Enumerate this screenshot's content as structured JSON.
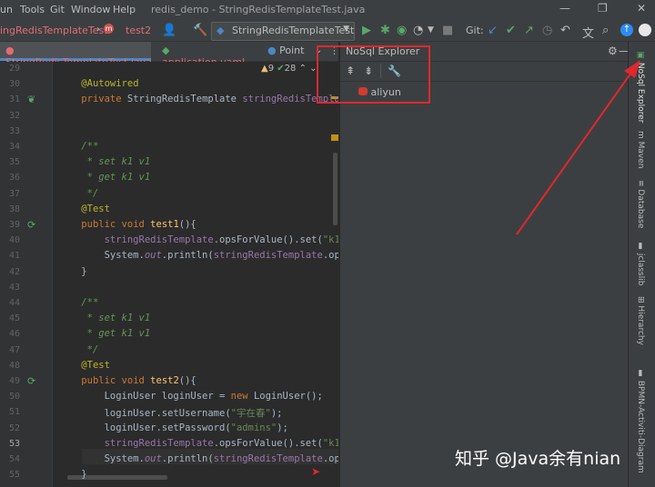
{
  "menu": {
    "items": [
      "un",
      "Tools",
      "Git",
      "Window",
      "Help"
    ],
    "window_title": "redis_demo - StringRedisTemplateTest.java"
  },
  "toolbar": {
    "breadcrumb_class": "ingRedisTemplateTest",
    "breadcrumb_method": "test2",
    "run_config": "StringRedisTemplateTest",
    "git_label": "Git:"
  },
  "tabs": [
    {
      "label": "StringRedisTemplateTest.java",
      "active": true
    },
    {
      "label": "application.yaml",
      "active": false
    },
    {
      "label": "Point",
      "active": false
    }
  ],
  "inspections": {
    "warnings": "9",
    "passed": "28"
  },
  "code_lines": [
    {
      "n": "29",
      "html": ""
    },
    {
      "n": "30",
      "html": "    <span class=\"ann\">@Autowired</span>"
    },
    {
      "n": "31",
      "html": "    <span class=\"kw\">private</span> StringRedisTemplate <span class=\"fld\">stringRedisTemplate</span>;"
    },
    {
      "n": "32",
      "html": ""
    },
    {
      "n": "33",
      "html": ""
    },
    {
      "n": "34",
      "html": "    <span class=\"doc\">/**</span>"
    },
    {
      "n": "35",
      "html": "<span class=\"doc\">     * set k1 v1</span>"
    },
    {
      "n": "36",
      "html": "<span class=\"doc\">     * get k1 v1</span>"
    },
    {
      "n": "37",
      "html": "<span class=\"doc\">     */</span>"
    },
    {
      "n": "38",
      "html": "    <span class=\"ann\">@Test</span>"
    },
    {
      "n": "39",
      "html": "    <span class=\"kw\">public void</span> <span class=\"fn\">test1</span>(){"
    },
    {
      "n": "40",
      "html": "        <span class=\"fld\">stringRedisTemplate</span>.opsForValue().set(<span class=\"str\">\"k1\"</span>"
    },
    {
      "n": "41",
      "html": "        System.<span class=\"fldi\">out</span>.println(<span class=\"fld\">stringRedisTemplate</span>.ops"
    },
    {
      "n": "42",
      "html": "    }"
    },
    {
      "n": "43",
      "html": ""
    },
    {
      "n": "44",
      "html": "    <span class=\"doc\">/**</span>"
    },
    {
      "n": "45",
      "html": "<span class=\"doc\">     * set k1 v1</span>"
    },
    {
      "n": "46",
      "html": "<span class=\"doc\">     * get k1 v1</span>"
    },
    {
      "n": "47",
      "html": "<span class=\"doc\">     */</span>"
    },
    {
      "n": "48",
      "html": "    <span class=\"ann\">@Test</span>"
    },
    {
      "n": "49",
      "html": "    <span class=\"kw\">public void</span> <span class=\"fn\">test2</span>(){"
    },
    {
      "n": "50",
      "html": "        LoginUser loginUser = <span class=\"kw\">new</span> LoginUser();"
    },
    {
      "n": "51",
      "html": "        loginUser.setUsername(<span class=\"str\">\"宇在春\"</span>);"
    },
    {
      "n": "52",
      "html": "        loginUser.setPassword(<span class=\"str\">\"admins\"</span>);"
    },
    {
      "n": "53",
      "html": "        <span class=\"fld\">stringRedisTemplate</span>.opsForValue().set(<span class=\"str\">\"k1\"</span>"
    },
    {
      "n": "54",
      "html": "        System.<span class=\"fldi\">out</span>.println(<span class=\"fld\">stringRedisTemplate</span>.ops"
    },
    {
      "n": "55",
      "html": "    }"
    }
  ],
  "panel": {
    "title": "NoSql Explorer",
    "connection": "aliyun"
  },
  "right_strip": [
    "NoSql Explorer",
    "Maven",
    "Database",
    "jclasslib",
    "Hierarchy",
    "BPMN-Activiti-Diagram"
  ],
  "watermark": "知乎 @Java余有nian",
  "colors": {
    "annotation": "#e0282e",
    "accent": "#4a88c7"
  }
}
